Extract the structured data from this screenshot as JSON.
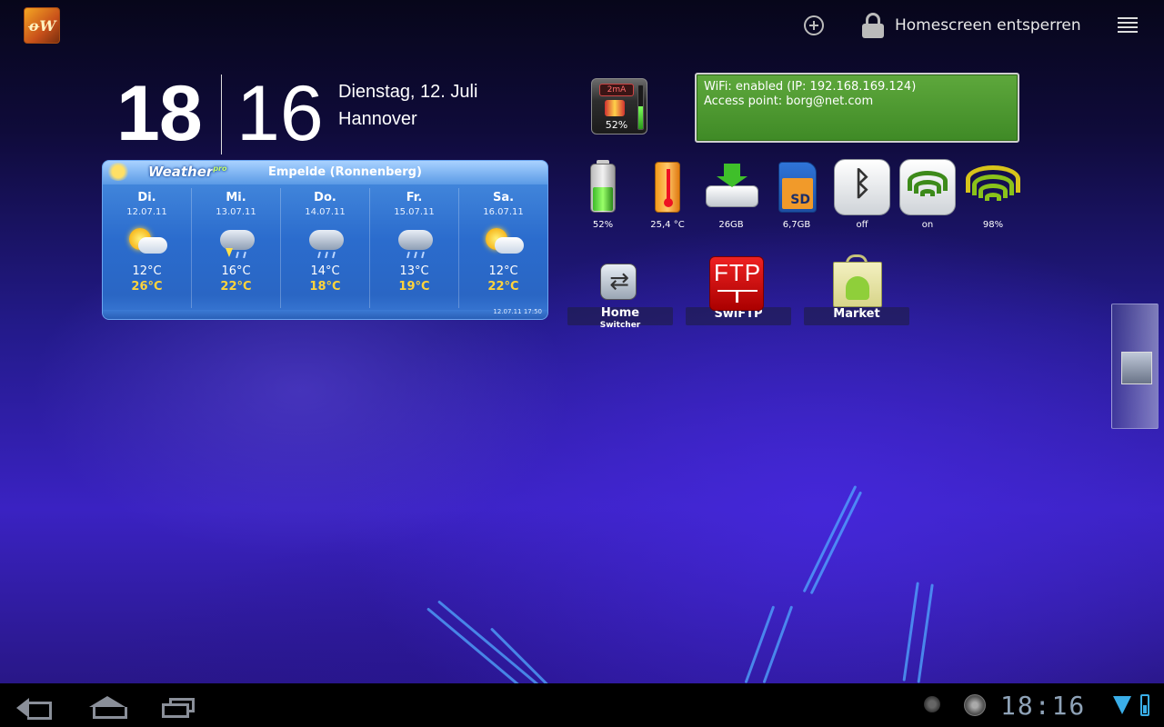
{
  "topbar": {
    "unlock_label": "Homescreen entsperren",
    "icons": [
      "app-logo",
      "add-icon",
      "lock-icon",
      "menu-icon"
    ]
  },
  "clock": {
    "hour": "18",
    "minute": "16",
    "date": "Dienstag, 12. Juli",
    "location": "Hannover"
  },
  "weather": {
    "brand": "Weather",
    "brand_suffix": "pro",
    "city": "Empelde (Ronnenberg)",
    "updated": "12.07.11 17:50",
    "days": [
      {
        "name": "Di.",
        "date": "12.07.11",
        "condition": "sun-cloud",
        "low": "12°C",
        "high": "26°C"
      },
      {
        "name": "Mi.",
        "date": "13.07.11",
        "condition": "thunderstorm",
        "low": "16°C",
        "high": "22°C"
      },
      {
        "name": "Do.",
        "date": "14.07.11",
        "condition": "rain",
        "low": "14°C",
        "high": "18°C"
      },
      {
        "name": "Fr.",
        "date": "15.07.11",
        "condition": "rain",
        "low": "13°C",
        "high": "19°C"
      },
      {
        "name": "Sa.",
        "date": "16.07.11",
        "condition": "sun-cloud",
        "low": "12°C",
        "high": "22°C"
      }
    ]
  },
  "battery_monitor": {
    "current": "2mA",
    "percent": "52%",
    "level_fraction": 0.52
  },
  "wifi_info": {
    "line1": "WiFi: enabled  (IP: 192.168.169.124)",
    "line2": "Access point: borg@net.com"
  },
  "toggles": [
    {
      "icon": "battery-icon",
      "label": "52%"
    },
    {
      "icon": "thermometer-icon",
      "label": "25,4 °C"
    },
    {
      "icon": "storage-icon",
      "label": "26GB"
    },
    {
      "icon": "sd-card-icon",
      "label": "6,7GB"
    },
    {
      "icon": "bluetooth-icon",
      "label": "off"
    },
    {
      "icon": "wifi-icon",
      "label": "on"
    },
    {
      "icon": "signal-icon",
      "label": "98%"
    }
  ],
  "apps": [
    {
      "icon": "home-switcher-icon",
      "label": "Home",
      "sublabel": "Switcher"
    },
    {
      "icon": "swiftp-icon",
      "label": "SwiFTP",
      "glyph": "FTP"
    },
    {
      "icon": "market-icon",
      "label": "Market"
    }
  ],
  "system_bar": {
    "time": "18:16",
    "colors": {
      "accent": "#3aaee8",
      "clock": "#8fa3b8"
    }
  }
}
